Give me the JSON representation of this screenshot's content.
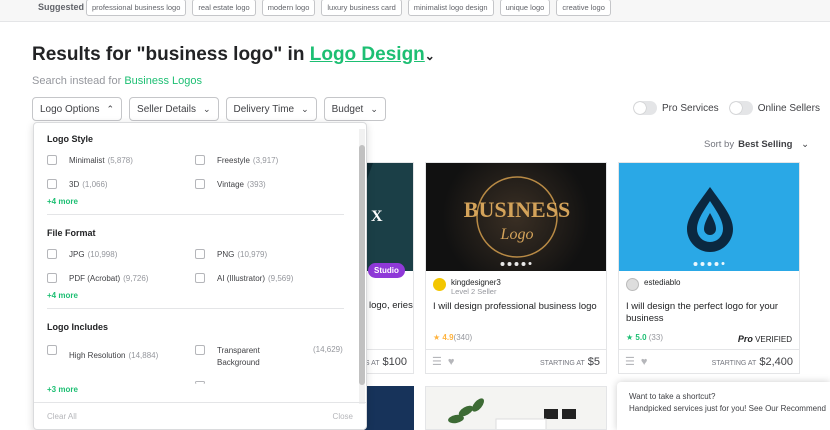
{
  "suggested": {
    "label": "Suggested",
    "chips": [
      "professional business logo",
      "real estate logo",
      "modern logo",
      "luxury business card",
      "minimalist logo design",
      "unique logo",
      "creative logo"
    ]
  },
  "header": {
    "title_prefix": "Results for \"business logo\" in",
    "title_category": "Logo Design",
    "search_instead_prefix": "Search instead for",
    "search_instead_link": "Business Logos"
  },
  "filters": [
    "Logo Options",
    "Seller Details",
    "Delivery Time",
    "Budget"
  ],
  "toggles": [
    "Pro Services",
    "Online Sellers"
  ],
  "sort": {
    "label": "Sort by",
    "value": "Best Selling"
  },
  "dropdown": {
    "sections": [
      {
        "title": "Logo Style",
        "options": [
          {
            "label": "Minimalist",
            "count": "(5,878)"
          },
          {
            "label": "Freestyle",
            "count": "(3,917)"
          },
          {
            "label": "3D",
            "count": "(1,066)"
          },
          {
            "label": "Vintage",
            "count": "(393)"
          }
        ],
        "more": "+4 more"
      },
      {
        "title": "File Format",
        "options": [
          {
            "label": "JPG",
            "count": "(10,998)"
          },
          {
            "label": "PNG",
            "count": "(10,979)"
          },
          {
            "label": "PDF (Acrobat)",
            "count": "(9,726)"
          },
          {
            "label": "AI (Illustrator)",
            "count": "(9,569)"
          }
        ],
        "more": "+4 more"
      },
      {
        "title": "Logo Includes",
        "options": [
          {
            "label": "High Resolution",
            "count": "(14,884)"
          },
          {
            "label": "Transparent Background",
            "count": "(14,629)"
          }
        ],
        "more": "+3 more"
      }
    ],
    "clear_all": "Clear All",
    "close": "Close"
  },
  "cards": [
    {
      "partial_title": "logo, eries",
      "price_prefix": "S AT",
      "price": "$100",
      "badge": "Studio"
    },
    {
      "seller": "kingdesigner3",
      "level": "Level 2 Seller",
      "title": "I will design professional business logo",
      "rating": "4.9",
      "reviews": "(340)",
      "price_prefix": "STARTING AT",
      "price": "$5",
      "image_text_1": "BUSINESS",
      "image_text_2": "Logo"
    },
    {
      "seller": "estediablo",
      "title": "I will design the perfect logo for your business",
      "rating": "5.0",
      "reviews": "(33)",
      "pro_label": "Pro",
      "pro_verified": "VERIFIED",
      "price_prefix": "STARTING AT",
      "price": "$2,400"
    }
  ],
  "shortcut": {
    "line1": "Want to take a shortcut?",
    "line2": "Handpicked services just for you! See Our Recommend"
  },
  "colors": {
    "accent": "#1dbf73",
    "studio": "#8f39d8",
    "star": "#ffb33e"
  }
}
